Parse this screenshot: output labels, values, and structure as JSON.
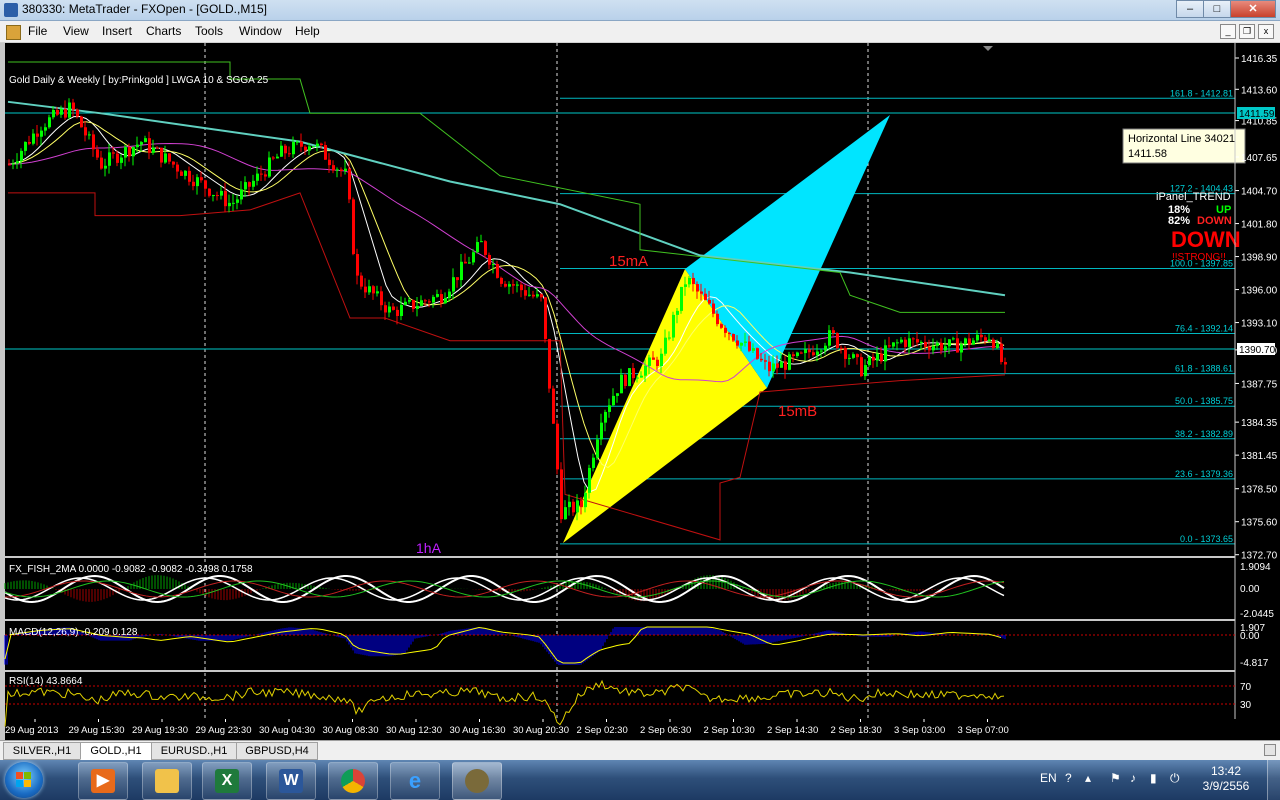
{
  "window": {
    "title": "380330: MetaTrader - FXOpen - [GOLD.,M15]",
    "min": "–",
    "max": "□",
    "close": "✕"
  },
  "menu": [
    "File",
    "View",
    "Insert",
    "Charts",
    "Tools",
    "Window",
    "Help"
  ],
  "mdi_buttons": [
    "_",
    "❐",
    "x"
  ],
  "main_chart": {
    "indicator_label": "Gold Daily & Weekly [ by:Prinkgold ] LWGA 10  &  SGGA 25",
    "price_ticks": [
      "1416.35",
      "1413.60",
      "1410.85",
      "1407.65",
      "1404.70",
      "1401.80",
      "1398.90",
      "1396.00",
      "1393.10",
      "1390.70",
      "1387.75",
      "1384.35",
      "1381.45",
      "1378.50",
      "1375.60",
      "1372.70"
    ],
    "fib_levels": [
      {
        "label": "161.8 - 1412.81",
        "price": 1412.81
      },
      {
        "label": "127.2 - 1404.43",
        "price": 1404.43
      },
      {
        "label": "100.0 - 1397.85",
        "price": 1397.85
      },
      {
        "label": "76.4 - 1392.14",
        "price": 1392.14
      },
      {
        "label": "61.8 - 1388.61",
        "price": 1388.61
      },
      {
        "label": "50.0 - 1385.75",
        "price": 1385.75
      },
      {
        "label": "38.2 - 1382.89",
        "price": 1382.89
      },
      {
        "label": "23.6 - 1379.36",
        "price": 1379.36
      },
      {
        "label": "0.0 - 1373.65",
        "price": 1373.65
      }
    ],
    "horizontal_line_price_tag": "1411.59",
    "current_price_tag": "1390.70",
    "tooltip": {
      "line1": "Horizontal Line 34021",
      "line2": "1411.58"
    },
    "pattern_labels": {
      "a": "15mA",
      "b": "15mB",
      "c": "1hA"
    },
    "ipanel": {
      "title": "iPanel_TREND",
      "up_pct": "18%",
      "up_label": "UP",
      "down_pct": "82%",
      "down_label": "DOWN",
      "big": "DOWN",
      "strong": "!!STRONG!!"
    }
  },
  "fish_panel": {
    "label": "FX_FISH_2MA 0.0000 -0.9082 -0.9082 -0.3498 0.1758",
    "ticks": [
      "1.9094",
      "0.00",
      "-2.0445"
    ]
  },
  "macd_panel": {
    "label": "MACD(12,26,9) -0.209 0.128",
    "ticks": [
      "1.907",
      "0.00",
      "-4.817"
    ]
  },
  "rsi_panel": {
    "label": "RSI(14) 43.8664",
    "ticks": [
      "70",
      "30"
    ]
  },
  "time_axis": [
    "29 Aug 2013",
    "29 Aug 15:30",
    "29 Aug 19:30",
    "29 Aug 23:30",
    "30 Aug 04:30",
    "30 Aug 08:30",
    "30 Aug 12:30",
    "30 Aug 16:30",
    "30 Aug 20:30",
    "2 Sep 02:30",
    "2 Sep 06:30",
    "2 Sep 10:30",
    "2 Sep 14:30",
    "2 Sep 18:30",
    "3 Sep 03:00",
    "3 Sep 07:00"
  ],
  "tabs": [
    "SILVER.,H1",
    "GOLD.,H1",
    "EURUSD.,H1",
    "GBPUSD,H4"
  ],
  "active_tab": 1,
  "tray": {
    "lang": "EN",
    "time": "13:42",
    "date": "3/9/2556"
  },
  "colors": {
    "bull": "#00ff00",
    "bear": "#ff0000",
    "fib": "#00c8c8",
    "pattern_yellow": "#ffff00",
    "pattern_cyan": "#00e5ff"
  }
}
